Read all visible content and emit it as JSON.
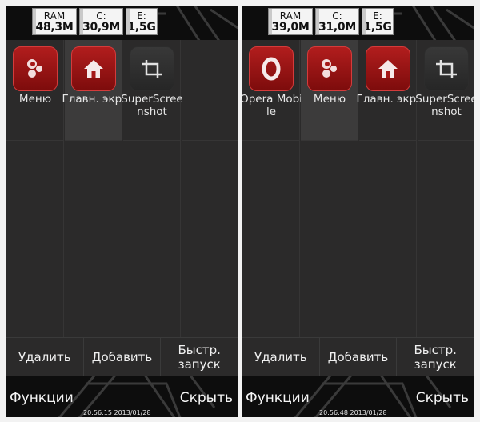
{
  "screens": [
    {
      "meters": {
        "ram": {
          "label": "RAM",
          "value": "48,3M"
        },
        "c": {
          "label": "C:",
          "value": "30,9M"
        },
        "e": {
          "label": "E:",
          "value": "1,5G"
        }
      },
      "apps": [
        {
          "name": "Меню",
          "icon": "menu-icon",
          "style": "red"
        },
        {
          "name": "Главн. экр.",
          "icon": "home-icon",
          "style": "red"
        },
        {
          "name": "SuperScreenshot",
          "icon": "screenshot-crop-icon",
          "style": "dark"
        }
      ],
      "selected_index": 1,
      "buttons": {
        "delete": "Удалить",
        "add": "Добавить",
        "quick_launch": "Быстр. запуск"
      },
      "softkeys": {
        "left": "Функции",
        "right": "Скрыть"
      },
      "clock": "20:56:15  2013/01/28"
    },
    {
      "meters": {
        "ram": {
          "label": "RAM",
          "value": "39,0M"
        },
        "c": {
          "label": "C:",
          "value": "31,0M"
        },
        "e": {
          "label": "E:",
          "value": "1,5G"
        }
      },
      "apps": [
        {
          "name": "Opera Mobile",
          "icon": "opera-icon",
          "style": "red"
        },
        {
          "name": "Меню",
          "icon": "menu-icon",
          "style": "red"
        },
        {
          "name": "Главн. экр.",
          "icon": "home-icon",
          "style": "red"
        },
        {
          "name": "SuperScreenshot",
          "icon": "screenshot-crop-icon",
          "style": "dark"
        }
      ],
      "selected_index": 1,
      "buttons": {
        "delete": "Удалить",
        "add": "Добавить",
        "quick_launch": "Быстр. запуск"
      },
      "softkeys": {
        "left": "Функции",
        "right": "Скрыть"
      },
      "clock": "20:56:48  2013/01/28"
    }
  ],
  "colors": {
    "accent_red": "#a81616",
    "background": "#2b2a2a"
  }
}
